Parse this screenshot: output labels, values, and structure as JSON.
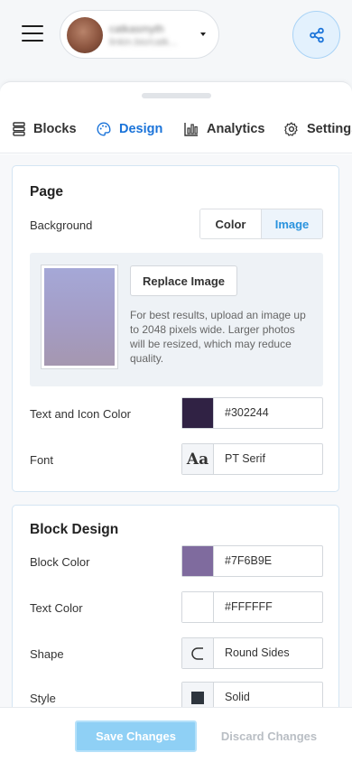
{
  "header": {
    "account": {
      "name": "catkasmyth",
      "subtitle": "linkin.bio/catk..."
    }
  },
  "tabs": [
    {
      "label": "Blocks",
      "icon": "stack-icon",
      "active": false
    },
    {
      "label": "Design",
      "icon": "palette-icon",
      "active": true
    },
    {
      "label": "Analytics",
      "icon": "bar-chart-icon",
      "active": false
    },
    {
      "label": "Settings",
      "icon": "gear-icon",
      "active": false
    }
  ],
  "page_section": {
    "title": "Page",
    "background": {
      "label": "Background",
      "options": [
        "Color",
        "Image"
      ],
      "selected": "Image"
    },
    "image": {
      "replace_label": "Replace Image",
      "help": "For best results, upload an image up to 2048 pixels wide. Larger photos will be resized, which may reduce quality."
    },
    "text_icon_color": {
      "label": "Text and Icon Color",
      "value": "#302244",
      "swatch": "#302244"
    },
    "font": {
      "label": "Font",
      "preview": "Aa",
      "value": "PT Serif"
    }
  },
  "block_section": {
    "title": "Block Design",
    "block_color": {
      "label": "Block Color",
      "value": "#7F6B9E",
      "swatch": "#7F6B9E"
    },
    "text_color": {
      "label": "Text Color",
      "value": "#FFFFFF",
      "swatch": "#FFFFFF"
    },
    "shape": {
      "label": "Shape",
      "value": "Round Sides",
      "icon": "round-sides-icon"
    },
    "style": {
      "label": "Style",
      "value": "Solid",
      "icon": "solid-square-icon"
    }
  },
  "footer": {
    "save_label": "Save Changes",
    "discard_label": "Discard Changes"
  },
  "colors": {
    "accent": "#1a73d9",
    "save_button": "#8fd0f5"
  }
}
